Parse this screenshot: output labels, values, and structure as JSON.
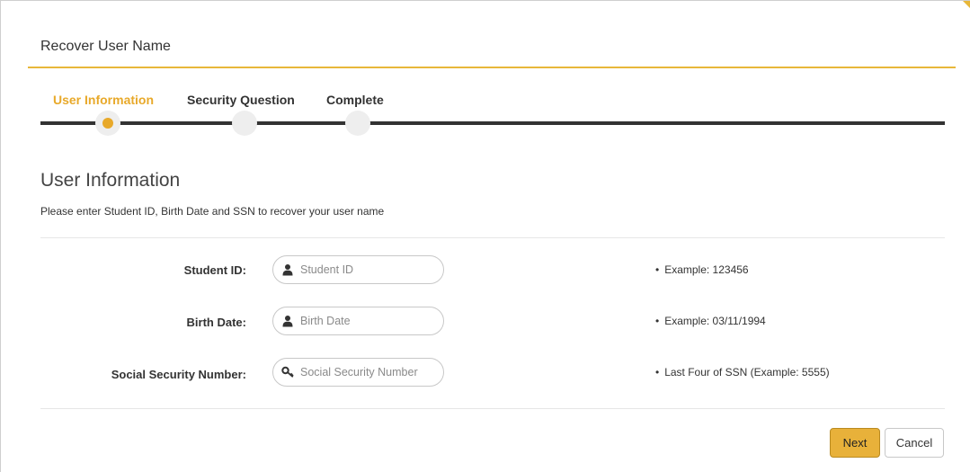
{
  "header": {
    "title": "Recover User Name"
  },
  "stepper": {
    "steps": [
      {
        "label": "User Information",
        "active": true
      },
      {
        "label": "Security Question",
        "active": false
      },
      {
        "label": "Complete",
        "active": false
      }
    ]
  },
  "section": {
    "title": "User Information",
    "description": "Please enter Student ID, Birth Date and SSN to recover your user name"
  },
  "form": {
    "fields": [
      {
        "label": "Student ID:",
        "placeholder": "Student ID",
        "value": "",
        "icon": "user-icon",
        "hint": "Example: 123456"
      },
      {
        "label": "Birth Date:",
        "placeholder": "Birth Date",
        "value": "",
        "icon": "user-icon",
        "hint": "Example: 03/11/1994"
      },
      {
        "label": "Social Security Number:",
        "placeholder": "Social Security Number",
        "value": "",
        "icon": "key-icon",
        "hint": "Last Four of SSN (Example: 5555)"
      }
    ],
    "hint_bullet": "•"
  },
  "actions": {
    "next_label": "Next",
    "cancel_label": "Cancel"
  },
  "colors": {
    "accent": "#e8b13a",
    "track": "#333333"
  }
}
